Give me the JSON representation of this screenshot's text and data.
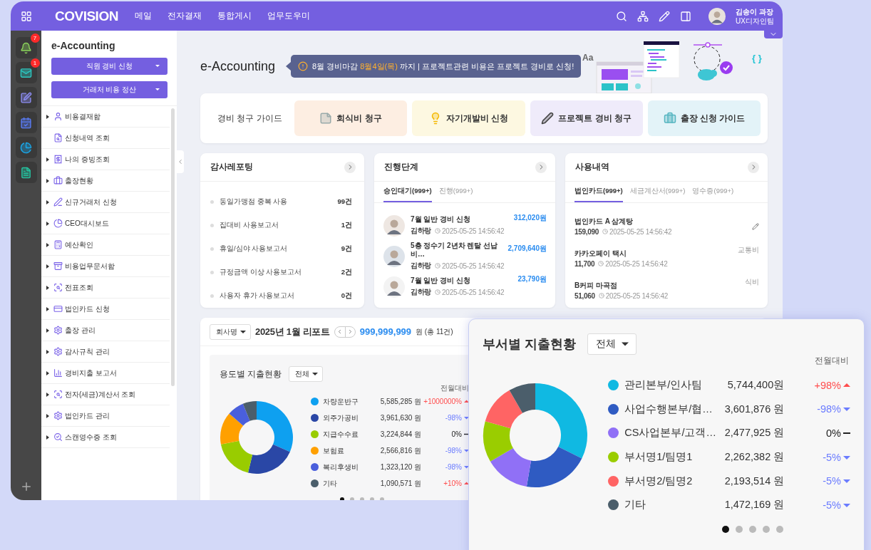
{
  "topbar": {
    "logo": "COVISION",
    "menu": [
      "메일",
      "전자결재",
      "통합게시",
      "업무도우미"
    ],
    "user": {
      "name": "김송이 과장",
      "team": "UX디자인팀"
    }
  },
  "rail": {
    "badges": [
      "7",
      "1"
    ]
  },
  "sidebar": {
    "title": "e-Accounting",
    "buttons": [
      "직원 경비 신청",
      "거래처 비용 정산"
    ],
    "items": [
      {
        "label": "비용결재함",
        "expandable": true
      },
      {
        "label": "신청내역 조회",
        "expandable": false
      },
      {
        "label": "나의 증빙조회",
        "expandable": true
      },
      {
        "label": "출장현황",
        "expandable": true
      },
      {
        "label": "신규거래처 신청",
        "expandable": true
      },
      {
        "label": "CEO대시보드",
        "expandable": true
      },
      {
        "label": "예산확인",
        "expandable": true
      },
      {
        "label": "비용업무문서함",
        "expandable": true
      },
      {
        "label": "전표조회",
        "expandable": true
      },
      {
        "label": "법인카드 신청",
        "expandable": true
      },
      {
        "label": "출장 관리",
        "expandable": true
      },
      {
        "label": "감사규칙 관리",
        "expandable": true
      },
      {
        "label": "경비지출 보고서",
        "expandable": true
      },
      {
        "label": "전자(세금)계산서 조회",
        "expandable": true
      },
      {
        "label": "법인카드 관리",
        "expandable": true
      },
      {
        "label": "스캔영수증 조회",
        "expandable": true
      }
    ]
  },
  "page": {
    "title": "e-Accounting",
    "notice": {
      "prefix": "8월 경비마감",
      "highlight": "8월4일(목)",
      "suffix": "까지 | 프로젝트관련 비용은 프로젝트 경비로 신청!"
    },
    "illustration_texts": [
      "Aa",
      "{ }"
    ]
  },
  "guide": {
    "label": "경비 청구 가이드",
    "buttons": [
      {
        "label": "회식비 청구",
        "color": "#fdeee2"
      },
      {
        "label": "자기개발비 신청",
        "color": "#fdf8e1"
      },
      {
        "label": "프로젝트 경비 청구",
        "color": "#efebfa"
      },
      {
        "label": "출장 신청 가이드",
        "color": "#e3f3f8"
      }
    ]
  },
  "audit": {
    "title": "감사레포팅",
    "rows": [
      {
        "label": "동일가맹점 중복 사용",
        "count": "99건"
      },
      {
        "label": "집대비 사용보고서",
        "count": "1건"
      },
      {
        "label": "휴일/심야 사용보고서",
        "count": "9건"
      },
      {
        "label": "규정금액 이상 사용보고서",
        "count": "2건"
      },
      {
        "label": "사용자 휴가 사용보고서",
        "count": "0건"
      }
    ]
  },
  "progress": {
    "title": "진행단계",
    "tabs": [
      {
        "label": "승인대기(999+)",
        "selected": true
      },
      {
        "label": "진행(999+)",
        "selected": false
      }
    ],
    "items": [
      {
        "title": "7월 일반 경비 신청",
        "name": "김하랑",
        "time": "2025-05-25 14:56:42",
        "amount": "312,020원"
      },
      {
        "title": "5층 정수기 2년차 렌탈 선납 비…",
        "name": "김하랑",
        "time": "2025-05-25 14:56:42",
        "amount": "2,709,640원"
      },
      {
        "title": "7월 일반 경비 신청",
        "name": "김하랑",
        "time": "2025-05-25 14:56:42",
        "amount": "23,790원"
      }
    ]
  },
  "usage": {
    "title": "사용내역",
    "tabs": [
      {
        "label": "법인카드(999+)",
        "selected": true
      },
      {
        "label": "세금계산서(999+)",
        "selected": false
      },
      {
        "label": "영수증(999+)",
        "selected": false
      }
    ],
    "items": [
      {
        "kind": "editable",
        "title": "법인카드 A 삼계탕",
        "amount": "159,090",
        "time": "2025-05-25 14:56:42"
      },
      {
        "kind": "categorized",
        "title": "카카오페이 택시",
        "amount": "11,700",
        "time": "2025-05-25 14:56:42",
        "category": "교통비"
      },
      {
        "kind": "categorized",
        "title": "B커피 마곡점",
        "amount": "51,060",
        "time": "2025-05-25 14:56:42",
        "category": "식비"
      }
    ]
  },
  "report": {
    "company_select": "회사명",
    "title": "2025년 1월 리포트",
    "total": "999,999,999",
    "total_suffix": "원 (총 11건)",
    "panel": {
      "title": "용도별 지출현황",
      "filter": "전체",
      "change_header": "전월대비",
      "legend": [
        {
          "amount": "5,585,285 원",
          "change": "+1000000%",
          "kind": "up",
          "color": "#0ea0f0"
        },
        {
          "amount": "3,961,630 원",
          "change": "-98%",
          "kind": "down",
          "color": "#2a47a6"
        },
        {
          "amount": "3,224,844 원",
          "change": "0%",
          "kind": "flat",
          "color": "#99cc00"
        },
        {
          "amount": "2,566,816 원",
          "change": "-98%",
          "kind": "down",
          "color": "#ffa000"
        },
        {
          "amount": "1,323,120 원",
          "change": "-98%",
          "kind": "down",
          "color": "#4a5fdc"
        },
        {
          "amount": "1,090,571 원",
          "change": "+10%",
          "kind": "up",
          "color": "#4b5e6b"
        }
      ],
      "chart_data": {
        "type": "donut",
        "categories": [
          "차량운반구",
          "외주가공비",
          "지급수수료",
          "보험료",
          "복리후생비",
          "기타"
        ],
        "values": [
          31.46,
          22.32,
          18.17,
          14.46,
          7.45,
          6.14
        ]
      },
      "pages": [
        {
          "selected": true
        },
        {
          "selected": false
        },
        {
          "selected": false
        },
        {
          "selected": false
        },
        {
          "selected": false
        }
      ]
    }
  },
  "overlay": {
    "title": "부서별 지출현황",
    "filter": "전체",
    "change_header": "전월대비",
    "legend": [
      {
        "amount": "5,744,400원",
        "change": "+98%",
        "kind": "up",
        "color": "#10b9e2"
      },
      {
        "amount": "3,601,876 원",
        "change": "-98%",
        "kind": "down",
        "color": "#2f5bc2"
      },
      {
        "amount": "2,477,925 원",
        "change": "0%",
        "kind": "flat",
        "color": "#9070f6"
      },
      {
        "amount": "2,262,382 원",
        "change": "-5%",
        "kind": "down",
        "color": "#9acd00"
      },
      {
        "amount": "2,193,514 원",
        "change": "-5%",
        "kind": "down",
        "color": "#ff6464"
      },
      {
        "amount": "1,472,169 원",
        "change": "-5%",
        "kind": "down",
        "color": "#4b5e6b"
      }
    ],
    "chart_data": {
      "type": "donut",
      "categories": [
        "관리본부/인사팀",
        "사업수행본부/협…",
        "CS사업본부/고객…",
        "부서명1/팀명1",
        "부서명2/팀명2",
        "기타"
      ],
      "values": [
        32.36,
        20.29,
        13.96,
        12.74,
        12.36,
        8.29
      ]
    },
    "pages": [
      {
        "selected": true
      },
      {
        "selected": false
      },
      {
        "selected": false
      },
      {
        "selected": false
      },
      {
        "selected": false
      }
    ]
  }
}
